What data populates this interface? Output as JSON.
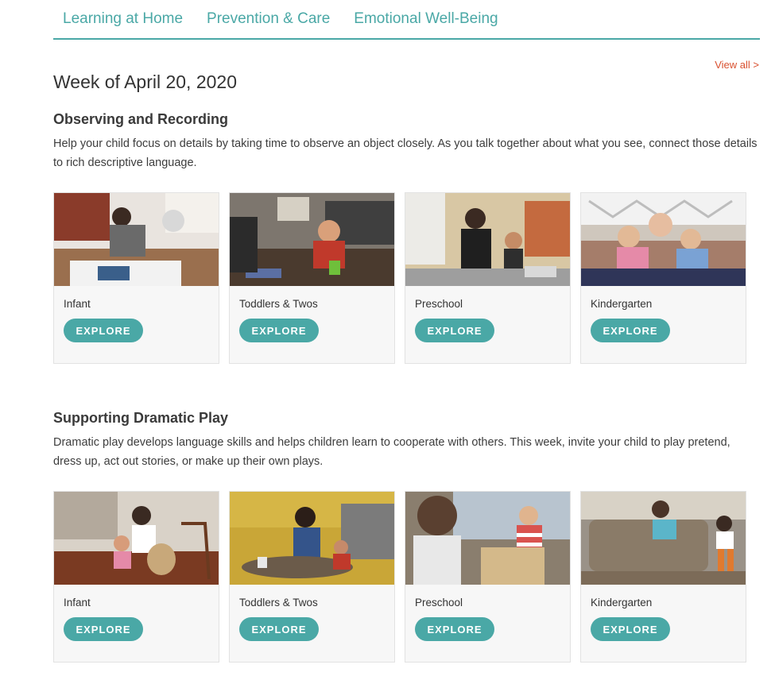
{
  "tabs": [
    {
      "label": "Learning at Home"
    },
    {
      "label": "Prevention & Care"
    },
    {
      "label": "Emotional Well-Being"
    }
  ],
  "view_all": "View all >",
  "week_title": "Week of April 20, 2020",
  "sections": [
    {
      "title": "Observing and Recording",
      "description": "Help your child focus on details by taking time to observe an object closely. As you talk together about what you see, connect those details to rich descriptive language.",
      "cards": [
        {
          "age": "Infant",
          "button": "EXPLORE"
        },
        {
          "age": "Toddlers & Twos",
          "button": "EXPLORE"
        },
        {
          "age": "Preschool",
          "button": "EXPLORE"
        },
        {
          "age": "Kindergarten",
          "button": "EXPLORE"
        }
      ]
    },
    {
      "title": "Supporting Dramatic Play",
      "description": "Dramatic play develops language skills and helps children learn to cooperate with others. This week, invite your child to play pretend, dress up, act out stories, or make up their own plays.",
      "cards": [
        {
          "age": "Infant",
          "button": "EXPLORE"
        },
        {
          "age": "Toddlers & Twos",
          "button": "EXPLORE"
        },
        {
          "age": "Preschool",
          "button": "EXPLORE"
        },
        {
          "age": "Kindergarten",
          "button": "EXPLORE"
        }
      ]
    }
  ],
  "colors": {
    "accent": "#4aa8a6",
    "link": "#d9502f",
    "card_bg": "#f7f7f7"
  }
}
